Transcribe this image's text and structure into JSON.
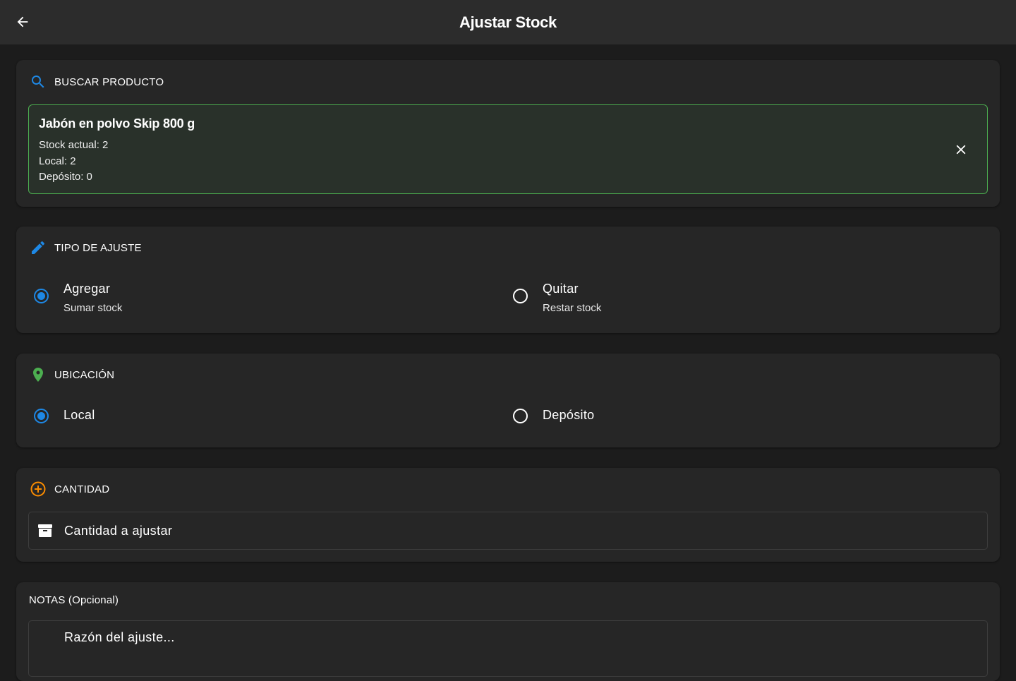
{
  "appbar": {
    "title": "Ajustar Stock"
  },
  "search": {
    "heading": "BUSCAR PRODUCTO",
    "product": {
      "name": "Jabón en polvo Skip 800 g",
      "stock": "Stock actual: 2",
      "local": "Local: 2",
      "deposito": "Depósito: 0"
    }
  },
  "tipo": {
    "heading": "TIPO DE AJUSTE",
    "options": [
      {
        "label": "Agregar",
        "sub": "Sumar stock",
        "selected": true
      },
      {
        "label": "Quitar",
        "sub": "Restar stock",
        "selected": false
      }
    ]
  },
  "ubicacion": {
    "heading": "UBICACIÓN",
    "options": [
      {
        "label": "Local",
        "selected": true
      },
      {
        "label": "Depósito",
        "selected": false
      }
    ]
  },
  "cantidad": {
    "heading": "CANTIDAD",
    "placeholder": "Cantidad a ajustar",
    "value": ""
  },
  "notas": {
    "heading": "NOTAS (Opcional)",
    "placeholder": "Razón del ajuste...",
    "value": ""
  },
  "colors": {
    "accent": "#1e88e5",
    "success": "#4caf50",
    "warning": "#fb8c00",
    "appbar": "#2c2c2c",
    "card": "#262626",
    "background": "#1c1c1c"
  },
  "icons": {
    "back": "arrow-left-icon",
    "search": "search-icon",
    "close": "close-icon",
    "edit": "pencil-icon",
    "location": "location-pin-icon",
    "add": "add-circle-icon",
    "quantity": "archive-box-icon"
  }
}
